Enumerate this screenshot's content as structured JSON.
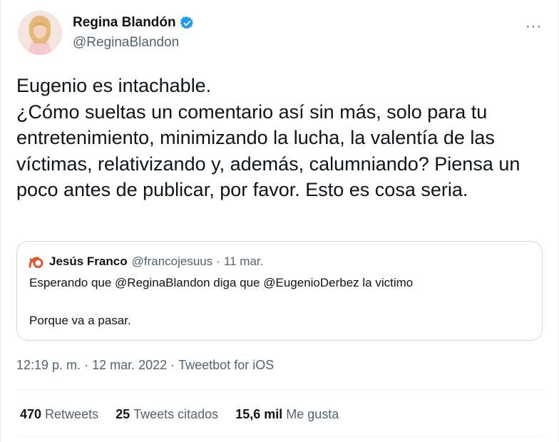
{
  "author": {
    "display_name": "Regina Blandón",
    "handle": "@ReginaBlandon",
    "verified": true,
    "avatar_icon": "profile-photo"
  },
  "more_label": "···",
  "tweet": {
    "text": "Eugenio es intachable.\n¿Cómo sueltas un comentario así sin más, solo para tu entretenimiento, minimizando la lucha, la valentía de las víctimas, relativizando y, además, calumniando? Piensa un poco antes de publicar, por favor. Esto es cosa seria."
  },
  "quoted_tweet": {
    "display_name": "Jesús Franco",
    "handle": "@francojesuus",
    "separator": "·",
    "date": "11 mar.",
    "line1": "Esperando que @ReginaBlandon diga que @EugenioDerbez la victimo",
    "line2": "Porque va a pasar."
  },
  "meta": {
    "time": "12:19 p. m.",
    "separator": "·",
    "date": "12 mar. 2022",
    "source": "Tweetbot for iOS"
  },
  "stats": {
    "retweets_count": "470",
    "retweets_label": "Retweets",
    "quotes_count": "25",
    "quotes_label": "Tweets citados",
    "likes_count": "15,6 mil",
    "likes_label": "Me gusta"
  },
  "colors": {
    "verified_badge": "#1d9bf0",
    "secondary_text": "#536471",
    "border": "#cfd9de"
  }
}
